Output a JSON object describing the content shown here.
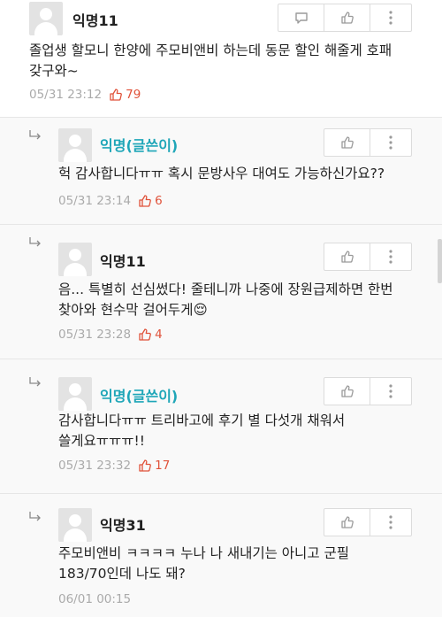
{
  "comments": [
    {
      "name": "익명11",
      "text_lines": [
        "졸업생 할모니 한양에 주모비앤비 하는데 동문 할인 해줄게 호패",
        "갖구와~"
      ],
      "time": "05/31 23:12",
      "likes": "79"
    },
    {
      "name": "익명(글쓴이)",
      "text_lines": [
        "헉 감사합니다ㅠㅠ 혹시 문방사우 대여도 가능하신가요??"
      ],
      "time": "05/31 23:14",
      "likes": "6"
    },
    {
      "name": "익명11",
      "text_lines": [
        "음... 특별히 선심썼다! 줄테니까 나중에 장원급제하면 한번",
        "찾아와 현수막 걸어두게😌"
      ],
      "time": "05/31 23:28",
      "likes": "4"
    },
    {
      "name": "익명(글쓴이)",
      "text_lines": [
        "감사합니다ㅠㅠ 트리바고에 후기 별 다섯개 채워서",
        "쓸게요ㅠㅠㅠ!!"
      ],
      "time": "05/31 23:32",
      "likes": "17"
    },
    {
      "name": "익명31",
      "text_lines": [
        "주모비앤비 ㅋㅋㅋㅋ 누나 나 새내기는 아니고 군필",
        "183/70인데 나도 돼?"
      ],
      "time": "06/01 00:15",
      "likes": ""
    }
  ],
  "icons": {
    "reply": "speech-bubble-icon",
    "like": "thumbs-up-icon",
    "more": "more-vertical-icon",
    "reply_arrow": "reply-arrow-icon"
  },
  "colors": {
    "writer_name": "#1fa6b8",
    "like_count": "#e0523a",
    "timestamp": "#aaaaaa"
  }
}
